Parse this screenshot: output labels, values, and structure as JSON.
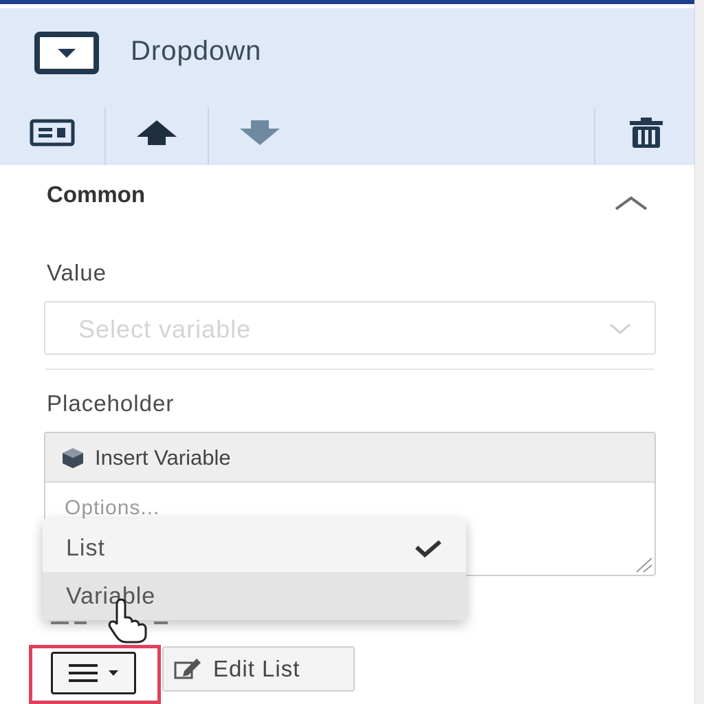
{
  "header": {
    "title": "Dropdown",
    "icon": "dropdown-icon",
    "toolbar": {
      "buttons": [
        "card-layout-icon",
        "arrow-up-icon",
        "arrow-down-icon",
        "trash-icon"
      ]
    }
  },
  "section": {
    "title": "Common",
    "collapse_icon": "chevron-up-icon"
  },
  "value_field": {
    "label": "Value",
    "placeholder": "Select variable"
  },
  "placeholder_field": {
    "label": "Placeholder",
    "insert_variable_label": "Insert Variable",
    "text": "Options..."
  },
  "menu": {
    "items": [
      {
        "label": "List",
        "selected": true
      },
      {
        "label": "Variable",
        "selected": false,
        "hovered": true
      }
    ]
  },
  "options_controls": {
    "mode_button_icon": "list-icon",
    "edit_list_label": "Edit List"
  },
  "colors": {
    "header_bg": "#dfe9f7",
    "accent_dark": "#22384e",
    "highlight_border": "#e0405a",
    "top_bar": "#1f3f8f"
  }
}
